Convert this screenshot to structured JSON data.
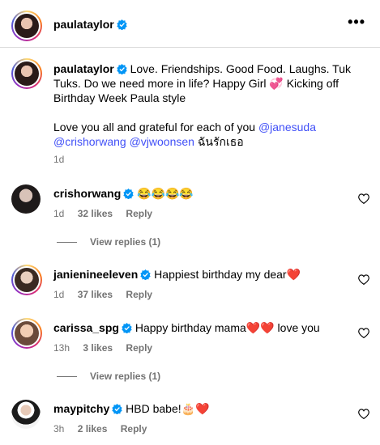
{
  "header": {
    "username": "paulataylor",
    "more_icon": "more-horizontal-icon"
  },
  "caption": {
    "username": "paulataylor",
    "text_1": "Love. Friendships. Good Food. Laughs. Tuk Tuks. Do we need more in life? Happy Girl",
    "emoji_1": "💞",
    "text_2": "Kicking off Birthday Week Paula style",
    "text_3": "Love you all and grateful for each of you",
    "mention_1": "@janesuda",
    "mention_2": "@crishorwang",
    "mention_3": "@vjwoonsen",
    "text_4": "ฉันรักเธอ",
    "time": "1d"
  },
  "comments": [
    {
      "username": "crishorwang",
      "text": "😂😂😂😂",
      "time": "1d",
      "likes": "32 likes",
      "reply": "Reply",
      "view_replies": "View replies (1)"
    },
    {
      "username": "janienineeleven",
      "text": "Happiest birthday my dear❤️",
      "time": "1d",
      "likes": "37 likes",
      "reply": "Reply"
    },
    {
      "username": "carissa_spg",
      "text": "Happy birthday mama❤️❤️ love you",
      "time": "13h",
      "likes": "3 likes",
      "reply": "Reply",
      "view_replies": "View replies (1)"
    },
    {
      "username": "maypitchy",
      "text": "HBD babe!🎂❤️",
      "time": "3h",
      "likes": "2 likes",
      "reply": "Reply"
    }
  ],
  "colors": {
    "verified": "#0095f6",
    "mention": "#4150f7",
    "meta": "#737373"
  }
}
